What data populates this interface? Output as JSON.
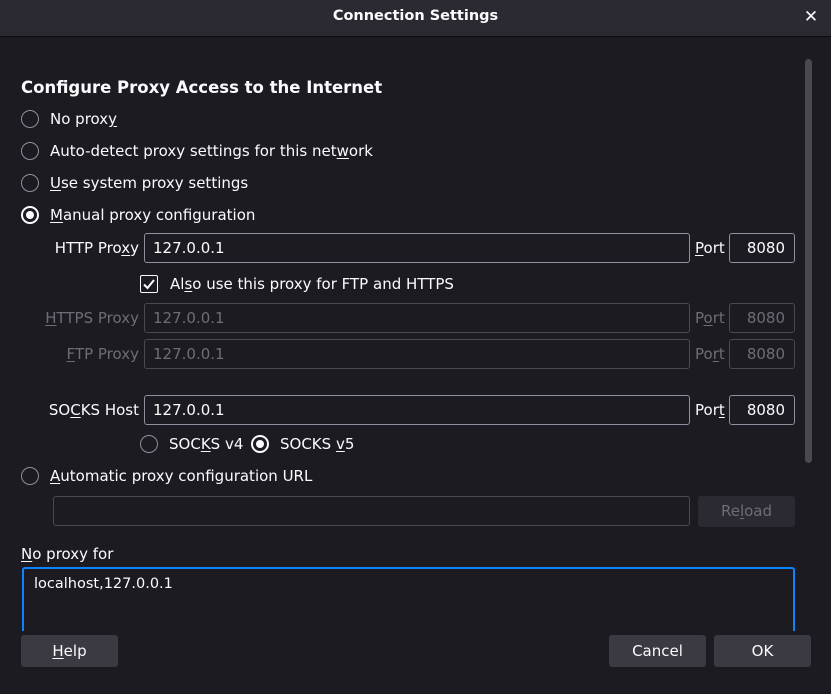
{
  "window": {
    "title": "Connection Settings"
  },
  "heading": "Configure Proxy Access to the Internet",
  "proxy_modes": {
    "no_proxy": {
      "pre": "No prox",
      "key": "y",
      "post": "",
      "checked": false
    },
    "auto_detect": {
      "pre": "Auto-detect proxy settings for this net",
      "key": "w",
      "post": "ork",
      "checked": false
    },
    "system": {
      "pre": "",
      "key": "U",
      "post": "se system proxy settings",
      "checked": false
    },
    "manual": {
      "pre": "",
      "key": "M",
      "post": "anual proxy configuration",
      "checked": true
    },
    "auto_url": {
      "pre": "",
      "key": "A",
      "post": "utomatic proxy configuration URL",
      "checked": false
    }
  },
  "http": {
    "label_pre": "HTTP Pro",
    "label_key": "x",
    "label_post": "y",
    "value": "127.0.0.1",
    "port_label_key": "P",
    "port_label_post": "ort",
    "port": "8080"
  },
  "also_use": {
    "pre": "Al",
    "key": "s",
    "post": "o use this proxy for FTP and HTTPS",
    "checked": true
  },
  "https": {
    "label_key": "H",
    "label_post": "TTPS Proxy",
    "placeholder": "127.0.0.1",
    "port_pre": "P",
    "port_key": "o",
    "port_post": "rt",
    "port": "8080"
  },
  "ftp": {
    "label_key": "F",
    "label_post": "TP Proxy",
    "placeholder": "127.0.0.1",
    "port_pre": "Po",
    "port_key": "r",
    "port_post": "t",
    "port": "8080"
  },
  "socks": {
    "label_pre": "SO",
    "label_key": "C",
    "label_post": "KS Host",
    "value": "127.0.0.1",
    "port_pre": "Por",
    "port_key": "t",
    "port": "8080",
    "v4": {
      "pre": "SOC",
      "key": "K",
      "post": "S v4",
      "checked": false
    },
    "v5": {
      "pre": "SOCKS ",
      "key": "v",
      "post": "5",
      "checked": true
    }
  },
  "auto_url": {
    "value": "",
    "reload_pre": "Re",
    "reload_key": "l",
    "reload_post": "oad"
  },
  "no_proxy_for": {
    "label_key": "N",
    "label_post": "o proxy for",
    "value": "localhost,127.0.0.1"
  },
  "footer": {
    "help_key": "H",
    "help_post": "elp",
    "cancel": "Cancel",
    "ok": "OK"
  },
  "colors": {
    "accent": "#0a84ff",
    "background": "#1c1b22",
    "titlebar": "#2b2a33",
    "button": "#3b3a42"
  },
  "icons": {
    "close": "close-icon",
    "check": "checkmark-icon"
  }
}
